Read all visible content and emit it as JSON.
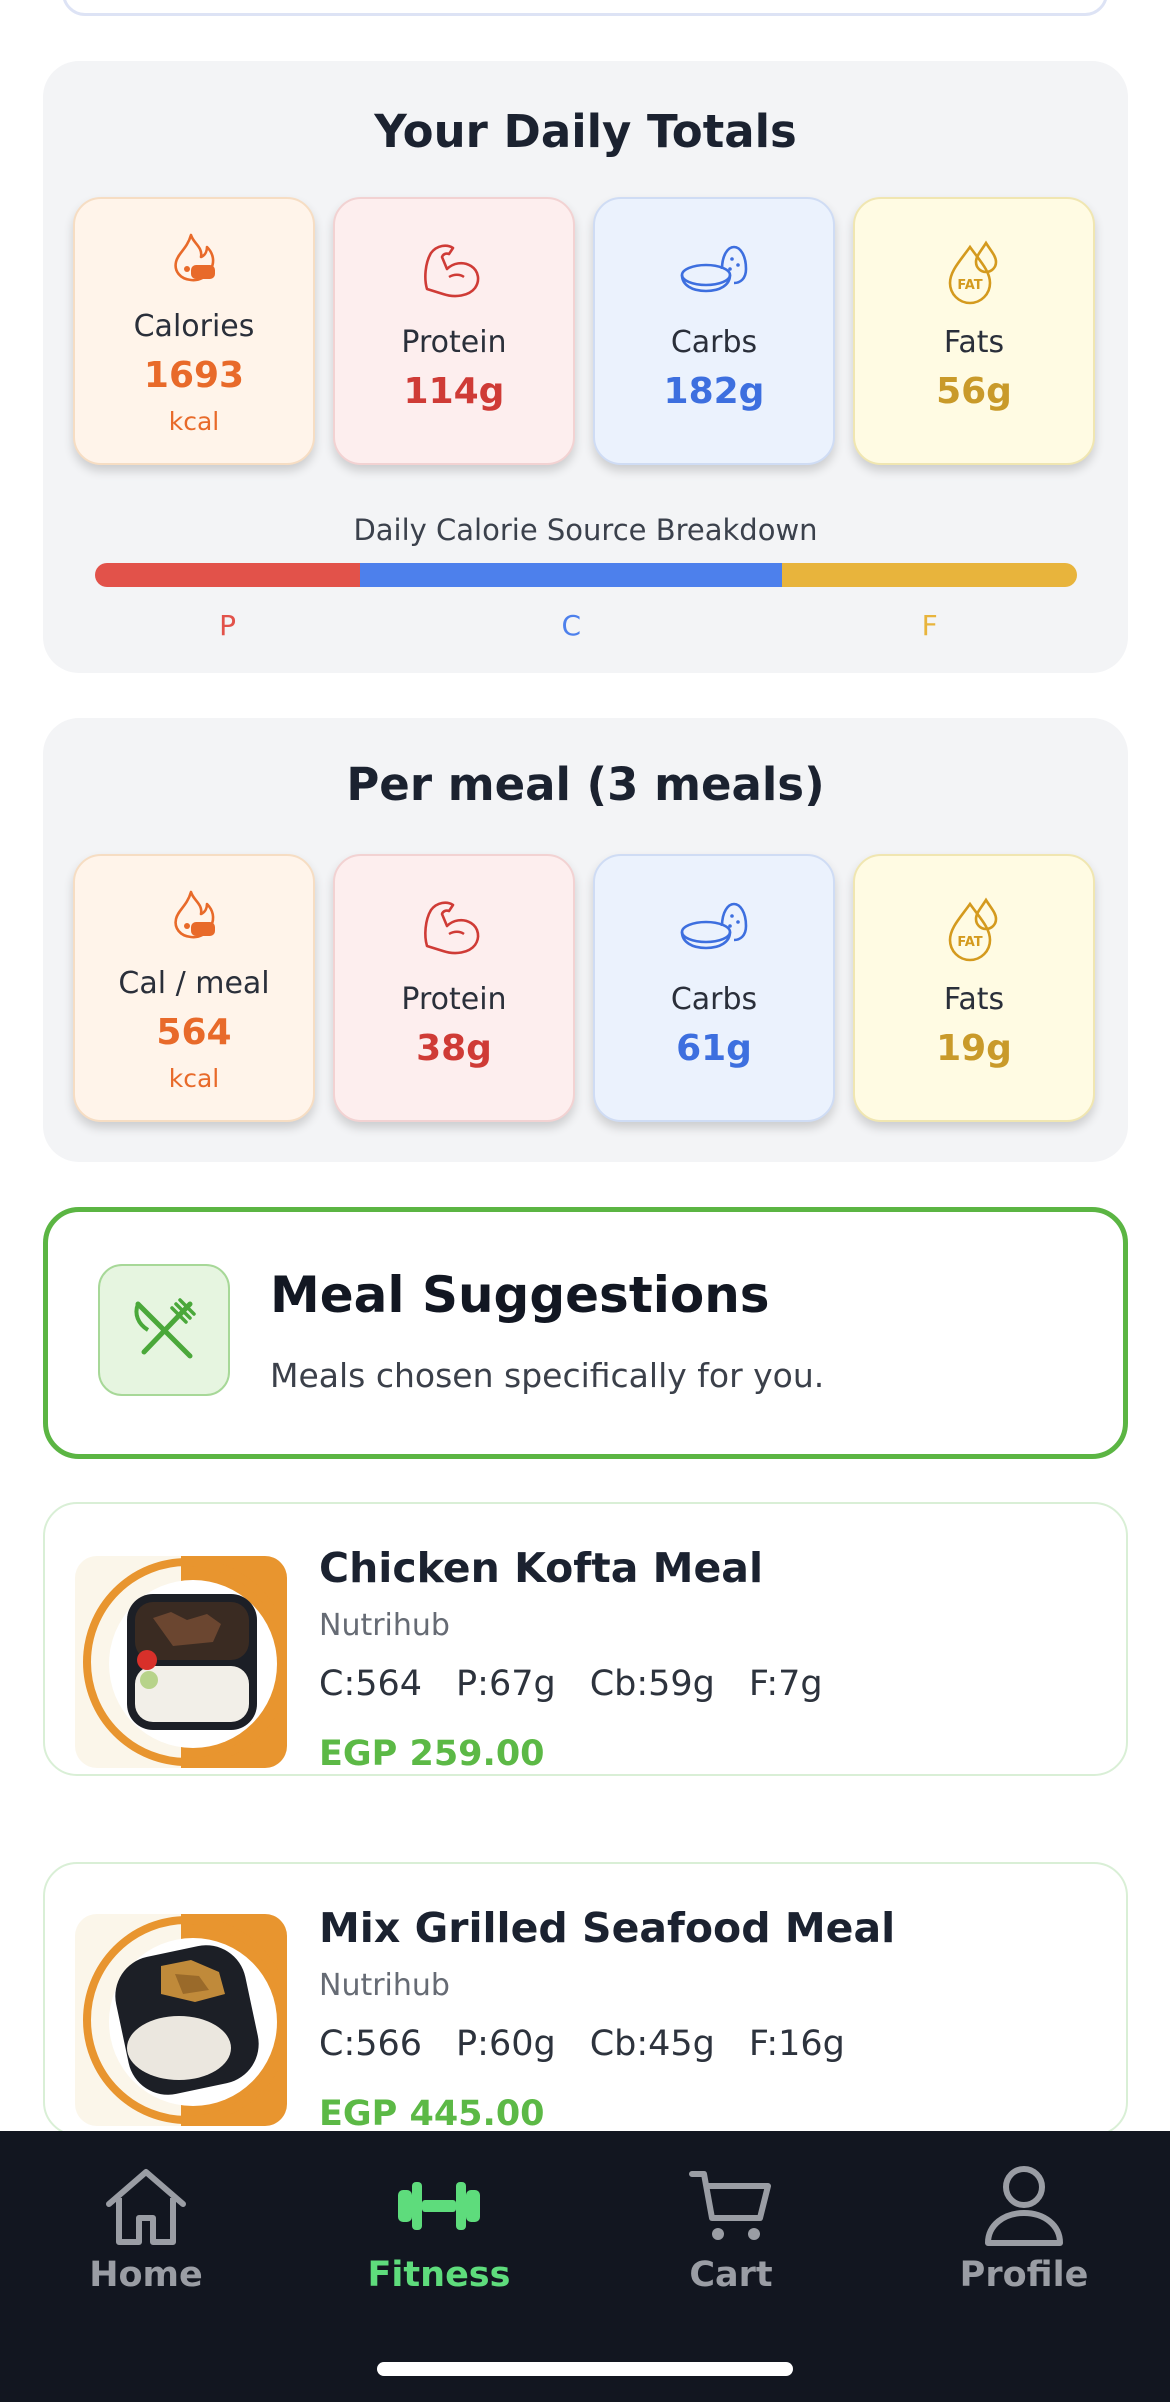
{
  "daily_totals": {
    "title": "Your Daily Totals",
    "calories": {
      "label": "Calories",
      "value": "1693",
      "unit": "kcal"
    },
    "protein": {
      "label": "Protein",
      "value": "114g"
    },
    "carbs": {
      "label": "Carbs",
      "value": "182g"
    },
    "fats": {
      "label": "Fats",
      "value": "56g"
    },
    "breakdown": {
      "title": "Daily Calorie Source Breakdown",
      "labels": {
        "protein": "P",
        "carbs": "C",
        "fats": "F"
      },
      "fractions": {
        "protein": 0.27,
        "carbs": 0.43,
        "fats": 0.3
      },
      "colors": {
        "protein": "#e2524a",
        "carbs": "#4d80ec",
        "fats": "#e8b43c"
      }
    }
  },
  "per_meal": {
    "title": "Per meal (3 meals)",
    "calories": {
      "label": "Cal / meal",
      "value": "564",
      "unit": "kcal"
    },
    "protein": {
      "label": "Protein",
      "value": "38g"
    },
    "carbs": {
      "label": "Carbs",
      "value": "61g"
    },
    "fats": {
      "label": "Fats",
      "value": "19g"
    }
  },
  "suggestions": {
    "title": "Meal Suggestions",
    "subtitle": "Meals chosen specifically for you.",
    "icon": "utensils-icon"
  },
  "meals": [
    {
      "name": "Chicken Kofta Meal",
      "brand": "Nutrihub",
      "cal": "C:564",
      "protein": "P:67g",
      "carbs": "Cb:59g",
      "fat": "F:7g",
      "price": "EGP 259.00"
    },
    {
      "name": "Mix Grilled Seafood Meal",
      "brand": "Nutrihub",
      "cal": "C:566",
      "protein": "P:60g",
      "carbs": "Cb:45g",
      "fat": "F:16g",
      "price": "EGP 445.00"
    }
  ],
  "tabbar": {
    "home": "Home",
    "fitness": "Fitness",
    "cart": "Cart",
    "profile": "Profile",
    "active": "fitness"
  },
  "colors": {
    "calories": "#e86a2a",
    "protein": "#cf3b36",
    "carbs": "#3d6fdf",
    "fats": "#c99a2a",
    "accent_green": "#5cb946"
  }
}
